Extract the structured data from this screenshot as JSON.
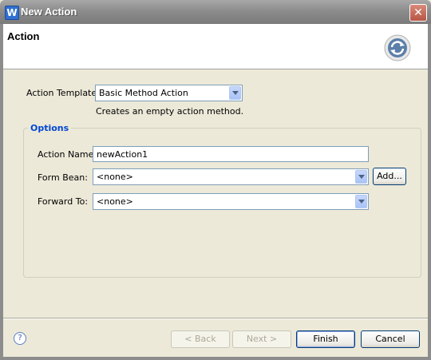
{
  "window": {
    "title": "New Action",
    "close_label": "✕",
    "app_icon_glyph": "W"
  },
  "banner": {
    "title": "Action",
    "icon": "refresh-wizard-icon"
  },
  "form": {
    "action_template_label": "Action Template:",
    "action_template_value": "Basic Method Action",
    "action_template_hint": "Creates an empty action method.",
    "options_group_label": "Options",
    "action_name_label": "Action Name:",
    "action_name_value": "newAction1",
    "form_bean_label": "Form Bean:",
    "form_bean_value": "<none>",
    "add_label": "Add...",
    "forward_to_label": "Forward To:",
    "forward_to_value": "<none>"
  },
  "footer": {
    "help_glyph": "?",
    "back_label": "< Back",
    "next_label": "Next >",
    "finish_label": "Finish",
    "cancel_label": "Cancel"
  },
  "colors": {
    "group_label": "#0046d5",
    "dialog_bg": "#ece9d8",
    "field_border": "#7f9db9"
  }
}
